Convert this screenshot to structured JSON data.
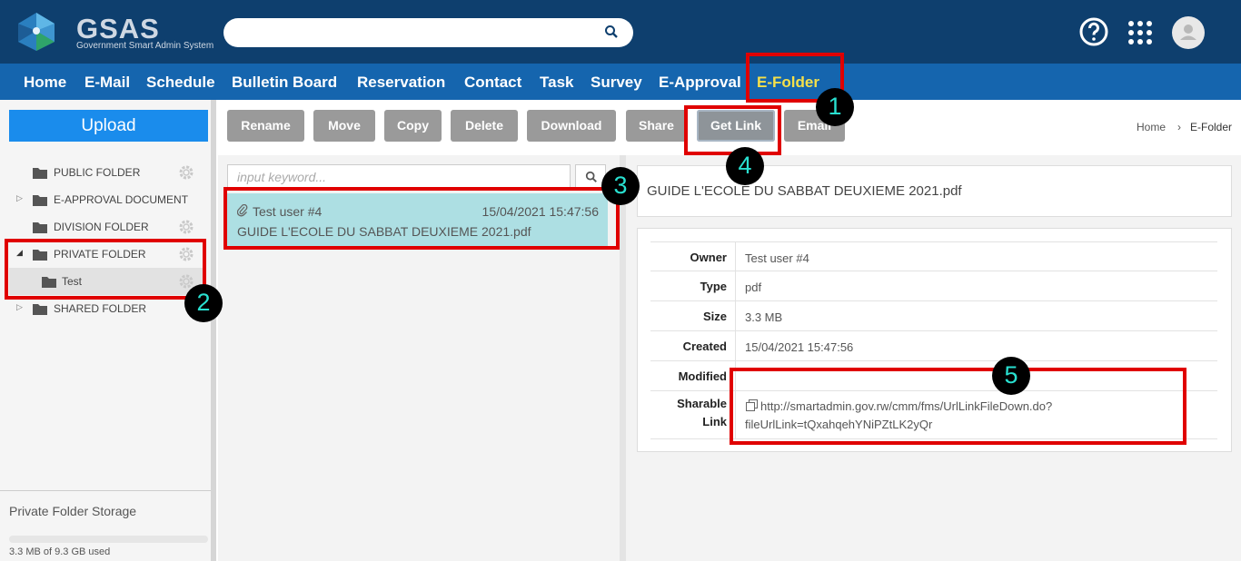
{
  "header": {
    "logo_text": "GSAS",
    "logo_subtitle": "Government Smart Admin System",
    "search_value": "",
    "help_icon": "help-circle-icon",
    "apps_icon": "grid-apps-icon",
    "avatar_icon": "user-avatar-icon"
  },
  "nav": {
    "items": [
      "Home",
      "E-Mail",
      "Schedule",
      "Bulletin Board",
      "Reservation",
      "Contact",
      "Task",
      "Survey",
      "E-Approval",
      "E-Folder"
    ],
    "active": "E-Folder"
  },
  "sidebar": {
    "upload_label": "Upload",
    "folders": [
      {
        "label": "PUBLIC FOLDER",
        "has_gear": true
      },
      {
        "label": "E-APPROVAL DOCUMENT",
        "has_gear": false,
        "expander": "▷"
      },
      {
        "label": "DIVISION FOLDER",
        "has_gear": true
      },
      {
        "label": "PRIVATE FOLDER",
        "has_gear": true,
        "expander": "◢"
      },
      {
        "label": "Test",
        "has_gear": true,
        "child": true
      },
      {
        "label": "SHARED FOLDER",
        "has_gear": false,
        "expander": "▷"
      }
    ],
    "storage_title": "Private Folder Storage",
    "storage_used": "3.3 MB of 9.3 GB used",
    "storage_fraction": 0.0003
  },
  "toolbar": {
    "buttons": [
      "Rename",
      "Move",
      "Copy",
      "Delete",
      "Download",
      "Share",
      "Get Link",
      "Email"
    ]
  },
  "breadcrumb": {
    "home": "Home",
    "separator": "›",
    "current": "E-Folder"
  },
  "file_list": {
    "search_placeholder": "input keyword...",
    "items": [
      {
        "user": "Test user #4",
        "date": "15/04/2021 15:47:56",
        "name": "GUIDE L'ECOLE DU SABBAT DEUXIEME 2021.pdf"
      }
    ]
  },
  "detail": {
    "title": "GUIDE L'ECOLE DU SABBAT DEUXIEME 2021.pdf",
    "rows": [
      {
        "label": "Owner",
        "value": "Test user #4"
      },
      {
        "label": "Type",
        "value": "pdf"
      },
      {
        "label": "Size",
        "value": "3.3 MB"
      },
      {
        "label": "Created",
        "value": "15/04/2021 15:47:56"
      },
      {
        "label": "Modified",
        "value": ""
      }
    ],
    "link_label_1": "Sharable",
    "link_label_2": "Link",
    "link_line_1": "http://smartadmin.gov.rw/cmm/fms/UrlLinkFileDown.do?",
    "link_line_2": "fileUrlLink=tQxahqehYNiPZtLK2yQr"
  },
  "annotations": [
    "1",
    "2",
    "3",
    "4",
    "5"
  ],
  "colors": {
    "topbar": "#0e3f6e",
    "navbar": "#1565ae",
    "active_nav": "#f5e04a",
    "upload": "#1a8cec",
    "highlight": "#e00000",
    "badge_text": "#29e0d0",
    "selected_row": "#addfe3"
  }
}
